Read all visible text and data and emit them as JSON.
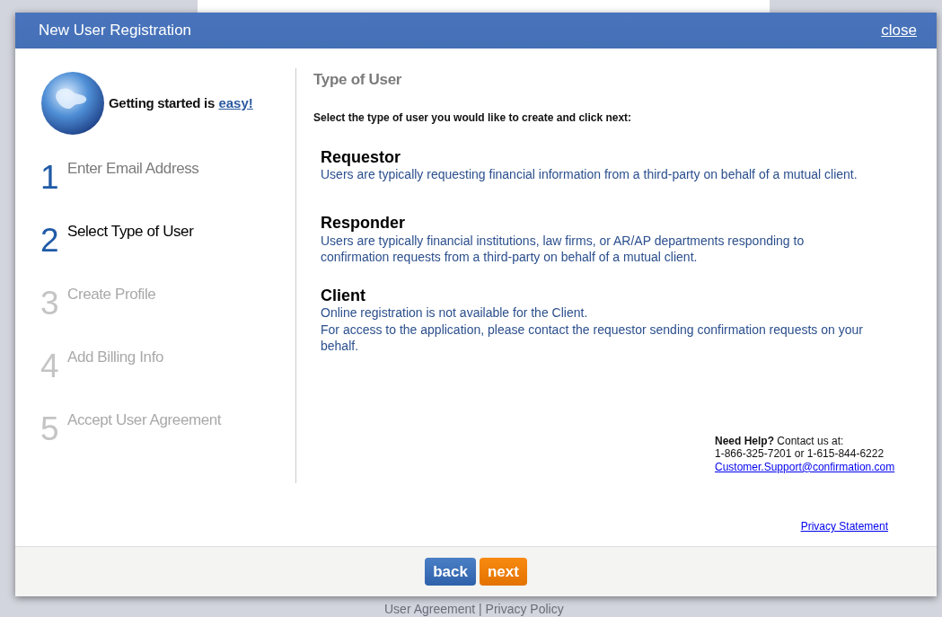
{
  "dialog": {
    "title": "New User Registration",
    "close": "close"
  },
  "brand": {
    "tagline": "Getting started is",
    "tagline_link": "easy!"
  },
  "steps": [
    {
      "number": "1",
      "label": "Enter Email Address",
      "selected": false,
      "disabled": false
    },
    {
      "number": "2",
      "label": "Select Type of User",
      "selected": true,
      "disabled": false
    },
    {
      "number": "3",
      "label": "Create Profile",
      "selected": false,
      "disabled": true
    },
    {
      "number": "4",
      "label": "Add Billing Info",
      "selected": false,
      "disabled": true
    },
    {
      "number": "5",
      "label": "Accept User Agreement",
      "selected": false,
      "disabled": true
    }
  ],
  "content": {
    "heading": "Type of User",
    "instruction": "Select the type of user you would like to create and click next:",
    "user_types": [
      {
        "name": "Requestor",
        "lines": [
          "Users are typically requesting financial information from a third-party on behalf of a mutual client."
        ]
      },
      {
        "name": "Responder",
        "lines": [
          "Users are typically financial institutions, law firms, or AR/AP departments responding to confirmation requests from a third-party on behalf of a mutual client."
        ]
      },
      {
        "name": "Client",
        "lines": [
          "Online registration is not available for the Client.",
          "For access to the application, please contact the requestor sending confirmation requests on your behalf."
        ]
      }
    ]
  },
  "help": {
    "text": "**Need Help?** Contact us at:",
    "phones": "1-866-325-7201 or 1-615-844-6222",
    "email": "Customer.Support@confirmation.com"
  },
  "privacy_link": "Privacy Statement",
  "buttons": [
    {
      "label": "back",
      "kind": "secondary"
    },
    {
      "label": "next",
      "kind": "primary"
    }
  ],
  "page_footer": "User Agreement | Privacy Policy"
}
